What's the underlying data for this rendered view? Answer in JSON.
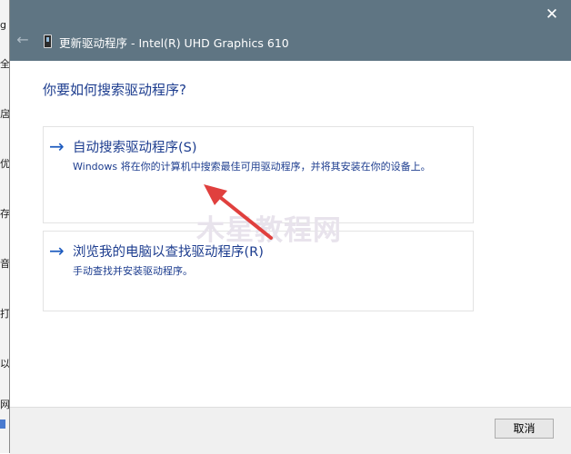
{
  "background_window": {
    "glyphs": [
      "g",
      "全",
      "扂",
      "优",
      "存",
      "音",
      "打",
      "以",
      "网"
    ]
  },
  "dialog": {
    "title": "更新驱动程序 - Intel(R) UHD Graphics 610",
    "close_glyph": "✕",
    "back_glyph": "←",
    "heading": "你要如何搜索驱动程序?",
    "options": [
      {
        "arrow": "→",
        "title": "自动搜索驱动程序(S)",
        "description": "Windows 将在你的计算机中搜索最佳可用驱动程序，并将其安装在你的设备上。"
      },
      {
        "arrow": "→",
        "title": "浏览我的电脑以查找驱动程序(R)",
        "description": "手动查找并安装驱动程序。"
      }
    ],
    "cancel_label": "取消"
  },
  "watermark": "木星教程网",
  "colors": {
    "titlebar": "#5f7583",
    "link_text": "#1d3d8f",
    "annotation_arrow": "#e0403e"
  },
  "icons": {
    "back": "back-arrow-icon",
    "close": "close-icon",
    "device": "device-icon",
    "option_arrow": "arrow-right-icon"
  }
}
